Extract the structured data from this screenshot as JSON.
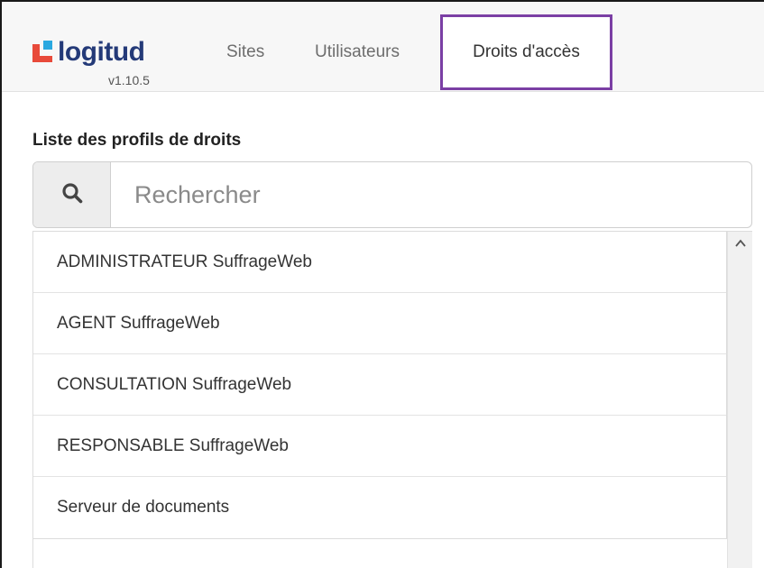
{
  "brand": {
    "name": "logitud",
    "version": "v1.10.5",
    "colors": {
      "text": "#243a78",
      "red": "#e84a3a",
      "blue": "#29a8e0"
    }
  },
  "nav": {
    "tabs": [
      {
        "label": "Sites"
      },
      {
        "label": "Utilisateurs"
      },
      {
        "label": "Droits d'accès",
        "active": true,
        "highlight_color": "#7b3fa4"
      }
    ]
  },
  "main": {
    "title": "Liste des profils de droits",
    "search": {
      "placeholder": "Rechercher",
      "value": "",
      "icon": "search-icon"
    },
    "profiles": [
      "ADMINISTRATEUR SuffrageWeb",
      "AGENT SuffrageWeb",
      "CONSULTATION SuffrageWeb",
      "RESPONSABLE SuffrageWeb",
      "Serveur de documents"
    ]
  }
}
